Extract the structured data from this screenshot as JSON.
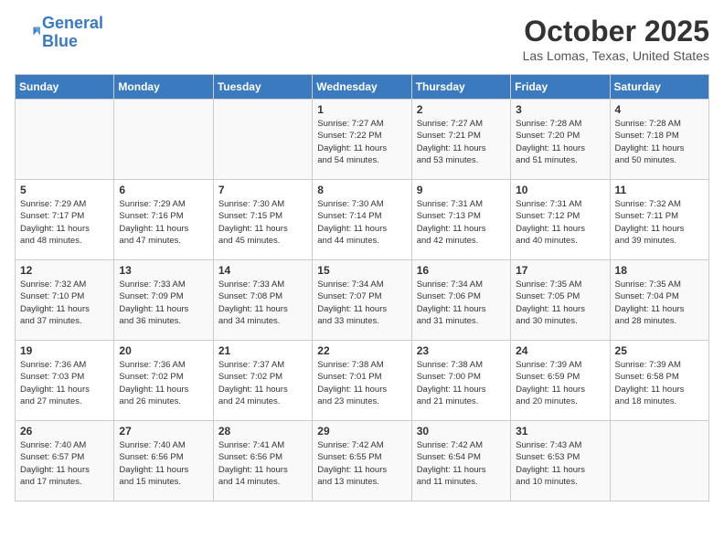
{
  "header": {
    "logo_line1": "General",
    "logo_line2": "Blue",
    "title": "October 2025",
    "location": "Las Lomas, Texas, United States"
  },
  "weekdays": [
    "Sunday",
    "Monday",
    "Tuesday",
    "Wednesday",
    "Thursday",
    "Friday",
    "Saturday"
  ],
  "weeks": [
    [
      {
        "day": "",
        "info": ""
      },
      {
        "day": "",
        "info": ""
      },
      {
        "day": "",
        "info": ""
      },
      {
        "day": "1",
        "info": "Sunrise: 7:27 AM\nSunset: 7:22 PM\nDaylight: 11 hours\nand 54 minutes."
      },
      {
        "day": "2",
        "info": "Sunrise: 7:27 AM\nSunset: 7:21 PM\nDaylight: 11 hours\nand 53 minutes."
      },
      {
        "day": "3",
        "info": "Sunrise: 7:28 AM\nSunset: 7:20 PM\nDaylight: 11 hours\nand 51 minutes."
      },
      {
        "day": "4",
        "info": "Sunrise: 7:28 AM\nSunset: 7:18 PM\nDaylight: 11 hours\nand 50 minutes."
      }
    ],
    [
      {
        "day": "5",
        "info": "Sunrise: 7:29 AM\nSunset: 7:17 PM\nDaylight: 11 hours\nand 48 minutes."
      },
      {
        "day": "6",
        "info": "Sunrise: 7:29 AM\nSunset: 7:16 PM\nDaylight: 11 hours\nand 47 minutes."
      },
      {
        "day": "7",
        "info": "Sunrise: 7:30 AM\nSunset: 7:15 PM\nDaylight: 11 hours\nand 45 minutes."
      },
      {
        "day": "8",
        "info": "Sunrise: 7:30 AM\nSunset: 7:14 PM\nDaylight: 11 hours\nand 44 minutes."
      },
      {
        "day": "9",
        "info": "Sunrise: 7:31 AM\nSunset: 7:13 PM\nDaylight: 11 hours\nand 42 minutes."
      },
      {
        "day": "10",
        "info": "Sunrise: 7:31 AM\nSunset: 7:12 PM\nDaylight: 11 hours\nand 40 minutes."
      },
      {
        "day": "11",
        "info": "Sunrise: 7:32 AM\nSunset: 7:11 PM\nDaylight: 11 hours\nand 39 minutes."
      }
    ],
    [
      {
        "day": "12",
        "info": "Sunrise: 7:32 AM\nSunset: 7:10 PM\nDaylight: 11 hours\nand 37 minutes."
      },
      {
        "day": "13",
        "info": "Sunrise: 7:33 AM\nSunset: 7:09 PM\nDaylight: 11 hours\nand 36 minutes."
      },
      {
        "day": "14",
        "info": "Sunrise: 7:33 AM\nSunset: 7:08 PM\nDaylight: 11 hours\nand 34 minutes."
      },
      {
        "day": "15",
        "info": "Sunrise: 7:34 AM\nSunset: 7:07 PM\nDaylight: 11 hours\nand 33 minutes."
      },
      {
        "day": "16",
        "info": "Sunrise: 7:34 AM\nSunset: 7:06 PM\nDaylight: 11 hours\nand 31 minutes."
      },
      {
        "day": "17",
        "info": "Sunrise: 7:35 AM\nSunset: 7:05 PM\nDaylight: 11 hours\nand 30 minutes."
      },
      {
        "day": "18",
        "info": "Sunrise: 7:35 AM\nSunset: 7:04 PM\nDaylight: 11 hours\nand 28 minutes."
      }
    ],
    [
      {
        "day": "19",
        "info": "Sunrise: 7:36 AM\nSunset: 7:03 PM\nDaylight: 11 hours\nand 27 minutes."
      },
      {
        "day": "20",
        "info": "Sunrise: 7:36 AM\nSunset: 7:02 PM\nDaylight: 11 hours\nand 26 minutes."
      },
      {
        "day": "21",
        "info": "Sunrise: 7:37 AM\nSunset: 7:02 PM\nDaylight: 11 hours\nand 24 minutes."
      },
      {
        "day": "22",
        "info": "Sunrise: 7:38 AM\nSunset: 7:01 PM\nDaylight: 11 hours\nand 23 minutes."
      },
      {
        "day": "23",
        "info": "Sunrise: 7:38 AM\nSunset: 7:00 PM\nDaylight: 11 hours\nand 21 minutes."
      },
      {
        "day": "24",
        "info": "Sunrise: 7:39 AM\nSunset: 6:59 PM\nDaylight: 11 hours\nand 20 minutes."
      },
      {
        "day": "25",
        "info": "Sunrise: 7:39 AM\nSunset: 6:58 PM\nDaylight: 11 hours\nand 18 minutes."
      }
    ],
    [
      {
        "day": "26",
        "info": "Sunrise: 7:40 AM\nSunset: 6:57 PM\nDaylight: 11 hours\nand 17 minutes."
      },
      {
        "day": "27",
        "info": "Sunrise: 7:40 AM\nSunset: 6:56 PM\nDaylight: 11 hours\nand 15 minutes."
      },
      {
        "day": "28",
        "info": "Sunrise: 7:41 AM\nSunset: 6:56 PM\nDaylight: 11 hours\nand 14 minutes."
      },
      {
        "day": "29",
        "info": "Sunrise: 7:42 AM\nSunset: 6:55 PM\nDaylight: 11 hours\nand 13 minutes."
      },
      {
        "day": "30",
        "info": "Sunrise: 7:42 AM\nSunset: 6:54 PM\nDaylight: 11 hours\nand 11 minutes."
      },
      {
        "day": "31",
        "info": "Sunrise: 7:43 AM\nSunset: 6:53 PM\nDaylight: 11 hours\nand 10 minutes."
      },
      {
        "day": "",
        "info": ""
      }
    ]
  ]
}
